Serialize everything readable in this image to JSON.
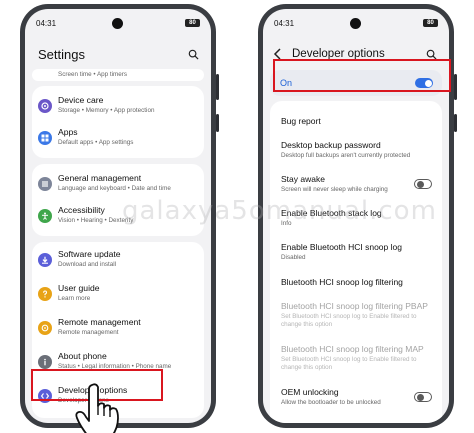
{
  "colors": {
    "highlight": "#d9161f",
    "accent_blue": "#2f6fe4",
    "on_text": "#1a5fd6",
    "icon_bg_device_care": "#6b57c8",
    "icon_bg_apps": "#3b78e7",
    "icon_bg_general": "#7d8599",
    "icon_bg_accessibility": "#3fa64b",
    "icon_bg_software_update": "#5b5fd9",
    "icon_bg_user_guide": "#e8a317",
    "icon_bg_remote": "#e8a317",
    "icon_bg_about_phone": "#6b6f78",
    "icon_bg_developer": "#5b5fd9"
  },
  "left_phone": {
    "status": {
      "time": "04:31",
      "battery": "80"
    },
    "header": {
      "title": "Settings",
      "search_icon": "search-icon"
    },
    "items": [
      {
        "title": "",
        "subtitle": "Screen time  •  App timers"
      },
      {
        "title": "Device care",
        "subtitle": "Storage  •  Memory  •  App protection",
        "icon": "device-care-icon"
      },
      {
        "title": "Apps",
        "subtitle": "Default apps  •  App settings",
        "icon": "apps-grid-icon"
      },
      {
        "title": "General management",
        "subtitle": "Language and keyboard  •  Date and time",
        "icon": "general-management-icon"
      },
      {
        "title": "Accessibility",
        "subtitle": "Vision  •  Hearing  •  Dexterity",
        "icon": "accessibility-icon"
      },
      {
        "title": "Software update",
        "subtitle": "Download and install",
        "icon": "software-update-icon"
      },
      {
        "title": "User guide",
        "subtitle": "Learn more",
        "icon": "user-guide-icon"
      },
      {
        "title": "Remote management",
        "subtitle": "Remote management",
        "icon": "remote-management-icon"
      },
      {
        "title": "About phone",
        "subtitle": "Status  •  Legal information  •  Phone name",
        "icon": "info-icon"
      },
      {
        "title": "Developer options",
        "subtitle": "Developer options",
        "icon": "developer-options-icon"
      }
    ]
  },
  "right_phone": {
    "status": {
      "time": "04:31",
      "battery": "80"
    },
    "header": {
      "title": "Developer options",
      "back_icon": "back-arrow-icon",
      "search_icon": "search-icon"
    },
    "master_switch": {
      "label": "On",
      "state": "on"
    },
    "options": [
      {
        "title": "Bug report",
        "subtitle": ""
      },
      {
        "title": "Desktop backup password",
        "subtitle": "Desktop full backups aren't currently protected"
      },
      {
        "title": "Stay awake",
        "subtitle": "Screen will never sleep while charging",
        "toggle": "off"
      },
      {
        "title": "Enable Bluetooth stack log",
        "subtitle": "Info"
      },
      {
        "title": "Enable Bluetooth HCI snoop log",
        "subtitle": "Disabled"
      },
      {
        "title": "Bluetooth HCI snoop log filtering",
        "subtitle": ""
      },
      {
        "title": "Bluetooth HCI snoop log filtering PBAP",
        "subtitle": "Set Bluetooth HCI snoop log to Enable filtered to change this option",
        "disabled": true
      },
      {
        "title": "Bluetooth HCI snoop log filtering MAP",
        "subtitle": "Set Bluetooth HCI snoop log to Enable filtered to change this option",
        "disabled": true
      },
      {
        "title": "OEM unlocking",
        "subtitle": "Allow the bootloader to be unlocked",
        "toggle": "off"
      }
    ]
  },
  "watermark": "galaxya5omanual.com"
}
